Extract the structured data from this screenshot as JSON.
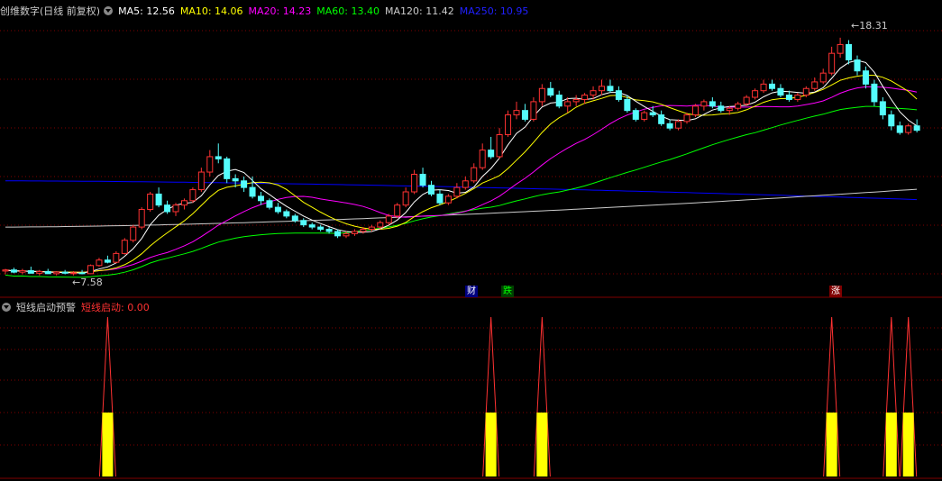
{
  "header": {
    "title": "创维数字(日线 前复权)",
    "ma": [
      {
        "label": "MA5:",
        "value": "12.56",
        "color": "#ffffff"
      },
      {
        "label": "MA10:",
        "value": "14.06",
        "color": "#ffff00"
      },
      {
        "label": "MA20:",
        "value": "14.23",
        "color": "#ff00ff"
      },
      {
        "label": "MA60:",
        "value": "13.40",
        "color": "#00ff00"
      },
      {
        "label": "MA120:",
        "value": "11.42",
        "color": "#cccccc"
      },
      {
        "label": "MA250:",
        "value": "10.95",
        "color": "#0000ff"
      }
    ]
  },
  "price_labels": {
    "high": "18.31",
    "low": "7.58"
  },
  "event_tags": {
    "cai": "财",
    "die": "跌",
    "zhang": "涨"
  },
  "indicator": {
    "title": "短线启动预警",
    "series_label": "短线启动:",
    "series_value": "0.00"
  },
  "colors": {
    "up": "#ff3232",
    "down": "#54fcfc",
    "grid": "#800000",
    "signal": "#ffff00",
    "ma250": "#0000ff",
    "ma120": "#cccccc",
    "ma60": "#00ff00",
    "ma20": "#ff00ff",
    "ma10": "#ffff00",
    "ma5": "#ffffff"
  },
  "chart_data": {
    "type": "candlestick",
    "y_range": [
      7.0,
      19.0
    ],
    "candles": [
      [
        7.7,
        7.8,
        7.55,
        7.75
      ],
      [
        7.75,
        7.85,
        7.6,
        7.65
      ],
      [
        7.65,
        7.8,
        7.55,
        7.72
      ],
      [
        7.72,
        7.9,
        7.6,
        7.6
      ],
      [
        7.6,
        7.75,
        7.5,
        7.68
      ],
      [
        7.68,
        7.8,
        7.58,
        7.58
      ],
      [
        7.58,
        7.7,
        7.5,
        7.65
      ],
      [
        7.65,
        7.75,
        7.55,
        7.6
      ],
      [
        7.6,
        7.7,
        7.5,
        7.62
      ],
      [
        7.62,
        7.75,
        7.55,
        7.58
      ],
      [
        7.58,
        8.0,
        7.58,
        7.95
      ],
      [
        7.95,
        8.3,
        7.9,
        8.2
      ],
      [
        8.2,
        8.4,
        8.05,
        8.1
      ],
      [
        8.1,
        8.6,
        8.05,
        8.5
      ],
      [
        8.5,
        9.2,
        8.45,
        9.1
      ],
      [
        9.1,
        9.8,
        9.0,
        9.7
      ],
      [
        9.7,
        10.6,
        9.6,
        10.5
      ],
      [
        10.5,
        11.3,
        10.4,
        11.2
      ],
      [
        11.2,
        11.5,
        10.6,
        10.7
      ],
      [
        10.7,
        10.9,
        10.3,
        10.4
      ],
      [
        10.4,
        10.8,
        10.2,
        10.7
      ],
      [
        10.7,
        11.0,
        10.5,
        10.9
      ],
      [
        10.9,
        11.5,
        10.8,
        11.4
      ],
      [
        11.4,
        12.4,
        11.3,
        12.2
      ],
      [
        12.2,
        13.2,
        12.0,
        12.9
      ],
      [
        12.9,
        13.5,
        12.6,
        12.8
      ],
      [
        12.8,
        12.9,
        11.7,
        11.9
      ],
      [
        11.9,
        12.1,
        11.5,
        11.8
      ],
      [
        11.8,
        12.0,
        11.3,
        11.5
      ],
      [
        11.5,
        12.0,
        11.0,
        11.1
      ],
      [
        11.1,
        11.3,
        10.7,
        10.9
      ],
      [
        10.9,
        11.0,
        10.5,
        10.6
      ],
      [
        10.6,
        10.8,
        10.3,
        10.4
      ],
      [
        10.4,
        10.5,
        10.1,
        10.2
      ],
      [
        10.2,
        10.3,
        9.9,
        10.0
      ],
      [
        10.0,
        10.1,
        9.7,
        9.8
      ],
      [
        9.8,
        9.9,
        9.6,
        9.7
      ],
      [
        9.7,
        9.8,
        9.5,
        9.6
      ],
      [
        9.6,
        9.7,
        9.4,
        9.5
      ],
      [
        9.5,
        9.6,
        9.2,
        9.3
      ],
      [
        9.3,
        9.5,
        9.2,
        9.4
      ],
      [
        9.4,
        9.6,
        9.3,
        9.5
      ],
      [
        9.5,
        9.7,
        9.4,
        9.6
      ],
      [
        9.6,
        9.8,
        9.5,
        9.7
      ],
      [
        9.7,
        10.0,
        9.6,
        9.9
      ],
      [
        9.9,
        10.3,
        9.8,
        10.2
      ],
      [
        10.2,
        10.8,
        10.1,
        10.7
      ],
      [
        10.7,
        11.5,
        10.6,
        11.3
      ],
      [
        11.3,
        12.3,
        11.2,
        12.1
      ],
      [
        12.1,
        12.4,
        11.5,
        11.6
      ],
      [
        11.6,
        11.8,
        11.1,
        11.2
      ],
      [
        11.2,
        11.4,
        10.7,
        10.8
      ],
      [
        10.8,
        11.2,
        10.7,
        11.1
      ],
      [
        11.1,
        11.7,
        11.0,
        11.5
      ],
      [
        11.5,
        12.0,
        11.4,
        11.8
      ],
      [
        11.8,
        12.6,
        11.7,
        12.4
      ],
      [
        12.4,
        13.5,
        12.3,
        13.2
      ],
      [
        13.2,
        13.8,
        12.8,
        12.9
      ],
      [
        12.9,
        14.2,
        12.8,
        13.9
      ],
      [
        13.9,
        15.0,
        13.8,
        14.8
      ],
      [
        14.8,
        15.4,
        14.6,
        15.0
      ],
      [
        15.0,
        15.3,
        14.5,
        14.6
      ],
      [
        14.6,
        15.6,
        14.5,
        15.4
      ],
      [
        15.4,
        16.2,
        15.2,
        16.0
      ],
      [
        16.0,
        16.3,
        15.6,
        15.7
      ],
      [
        15.7,
        15.9,
        15.1,
        15.2
      ],
      [
        15.2,
        15.6,
        14.9,
        15.4
      ],
      [
        15.4,
        15.7,
        15.2,
        15.5
      ],
      [
        15.5,
        15.8,
        15.3,
        15.7
      ],
      [
        15.7,
        16.1,
        15.5,
        15.9
      ],
      [
        15.9,
        16.4,
        15.7,
        16.1
      ],
      [
        16.1,
        16.4,
        15.8,
        15.9
      ],
      [
        15.9,
        16.1,
        15.4,
        15.5
      ],
      [
        15.5,
        15.7,
        14.9,
        15.0
      ],
      [
        15.0,
        15.1,
        14.5,
        14.6
      ],
      [
        14.6,
        15.0,
        14.5,
        14.9
      ],
      [
        14.9,
        15.2,
        14.7,
        14.8
      ],
      [
        14.8,
        15.0,
        14.3,
        14.4
      ],
      [
        14.4,
        14.6,
        14.1,
        14.2
      ],
      [
        14.2,
        14.6,
        14.1,
        14.5
      ],
      [
        14.5,
        14.9,
        14.4,
        14.8
      ],
      [
        14.8,
        15.3,
        14.7,
        15.2
      ],
      [
        15.2,
        15.5,
        15.0,
        15.4
      ],
      [
        15.4,
        15.6,
        15.1,
        15.2
      ],
      [
        15.2,
        15.4,
        14.9,
        15.0
      ],
      [
        15.0,
        15.2,
        14.8,
        15.1
      ],
      [
        15.1,
        15.4,
        15.0,
        15.3
      ],
      [
        15.3,
        15.7,
        15.2,
        15.6
      ],
      [
        15.6,
        16.0,
        15.5,
        15.9
      ],
      [
        15.9,
        16.4,
        15.8,
        16.2
      ],
      [
        16.2,
        16.4,
        15.9,
        16.0
      ],
      [
        16.0,
        16.2,
        15.6,
        15.7
      ],
      [
        15.7,
        15.9,
        15.4,
        15.5
      ],
      [
        15.5,
        15.8,
        15.4,
        15.7
      ],
      [
        15.7,
        16.1,
        15.6,
        16.0
      ],
      [
        16.0,
        16.5,
        15.9,
        16.3
      ],
      [
        16.3,
        16.9,
        16.2,
        16.7
      ],
      [
        16.7,
        17.9,
        16.6,
        17.6
      ],
      [
        17.6,
        18.31,
        17.4,
        18.0
      ],
      [
        18.0,
        18.2,
        17.1,
        17.3
      ],
      [
        17.3,
        17.5,
        16.6,
        16.8
      ],
      [
        16.8,
        17.0,
        16.0,
        16.2
      ],
      [
        16.2,
        16.4,
        15.2,
        15.4
      ],
      [
        15.4,
        15.6,
        14.6,
        14.8
      ],
      [
        14.8,
        15.0,
        14.1,
        14.3
      ],
      [
        14.3,
        14.5,
        13.9,
        14.0
      ],
      [
        14.0,
        14.4,
        13.9,
        14.3
      ],
      [
        14.3,
        14.6,
        14.0,
        14.1
      ]
    ],
    "ma_levels": {
      "MA5": 12.56,
      "MA10": 14.06,
      "MA20": 14.23,
      "MA60": 13.4,
      "MA120": 11.42,
      "MA250": 10.95
    },
    "signals": [
      12,
      57,
      63,
      97,
      104,
      106
    ]
  }
}
